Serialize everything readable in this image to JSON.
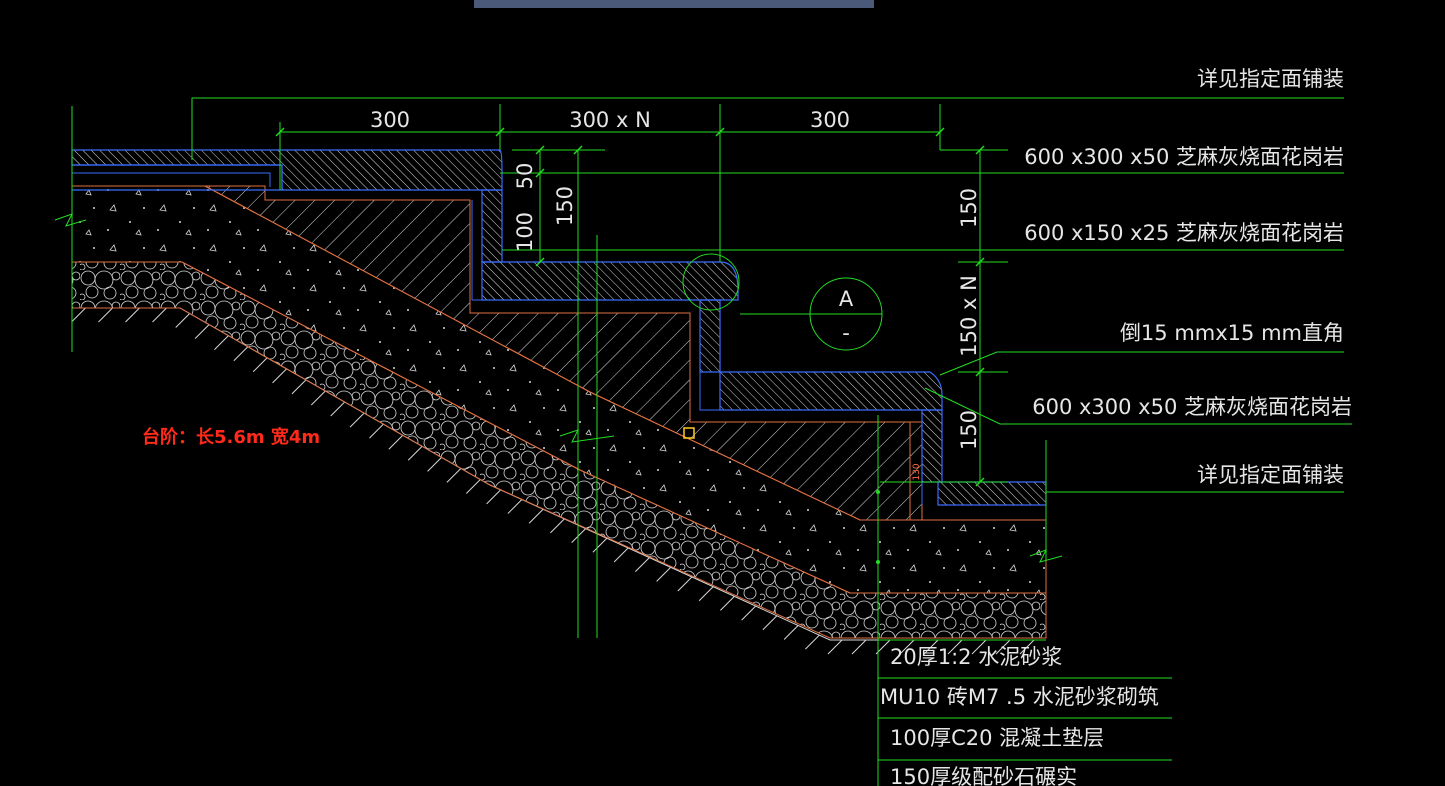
{
  "drawing": {
    "callouts": {
      "top_finish": "详见指定面铺装",
      "slab_600x300": "600 x300 x50 芝麻灰烧面花岗岩",
      "riser_600x150": "600 x150 x25 芝麻灰烧面花岗岩",
      "chamfer": "倒15 mmx15 mm直角",
      "tread_600x300": "600 x300 x50 芝麻灰烧面花岗岩",
      "bottom_finish": "详见指定面铺装"
    },
    "dimensions": {
      "d300_left": "300",
      "d300xN": "300 x N",
      "d300_right": "300",
      "d50": "50",
      "d100": "100",
      "d150_left": "150",
      "d150_right_top": "150",
      "d150xN": "150 x N",
      "d150_right_bottom": "150",
      "d130": "130"
    },
    "detail_marker": {
      "letter": "A",
      "sub": "-"
    },
    "note": "台阶：长5.6m  宽4m",
    "layers": [
      "20厚1:2 水泥砂浆",
      "MU10 砖M7 .5 水泥砂浆砌筑",
      "100厚C20 混凝土垫层",
      "150厚级配砂石碾实"
    ],
    "colors": {
      "background": "#000000",
      "leader": "#22dd22",
      "stone": "#3a6cff",
      "concrete": "#e07040",
      "hatch": "#d8d8d8",
      "note": "#ff2a1a",
      "topbar": "#4a5a78"
    }
  }
}
